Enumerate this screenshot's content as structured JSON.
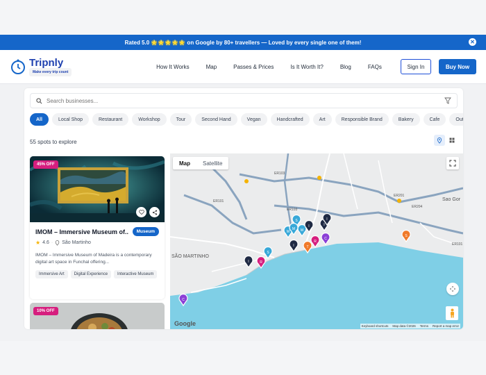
{
  "banner": {
    "text": "Rated 5.0 🌟🌟🌟🌟🌟 on Google by 80+ travellers — Loved by every single one of them!"
  },
  "brand": {
    "name": "Tripnly",
    "tagline": "Make every trip count",
    "color": "#1566c9"
  },
  "nav": [
    "How It Works",
    "Map",
    "Passes & Prices",
    "Is It Worth It?",
    "Blog",
    "FAQs"
  ],
  "auth": {
    "signin": "Sign In",
    "buy": "Buy Now"
  },
  "search": {
    "placeholder": "Search businesses..."
  },
  "filters": [
    "All",
    "Local Shop",
    "Restaurant",
    "Workshop",
    "Tour",
    "Second Hand",
    "Vegan",
    "Handcrafted",
    "Art",
    "Responsible Brand",
    "Bakery",
    "Cafe",
    "Outdoor"
  ],
  "results": {
    "count": "55 spots to explore"
  },
  "card": {
    "discount": "45% OFF",
    "title": "IMOM – Immersive Museum of...",
    "category": "Museum",
    "rating": "4.6",
    "location": "São Martinho",
    "description": "IMOM – Immersive Museum of Madeira is a contemporary digital art space in Funchal offering...",
    "tags": [
      "Immersive Art",
      "Digital Experience",
      "Interactive Museum"
    ]
  },
  "card2": {
    "discount": "10% OFF"
  },
  "map": {
    "tabs": [
      "Map",
      "Satellite"
    ],
    "labels": [
      "SÃO MARTINHO",
      "Sao Gor",
      "ER103",
      "ER101",
      "ER201",
      "ER204",
      "ER103",
      "ER101"
    ],
    "attribution": [
      "Keyboard shortcuts",
      "Map data ©2026",
      "Terms",
      "Report a map error"
    ],
    "logo": "Google",
    "pins": [
      {
        "label": "S",
        "color": "#38a8d8"
      },
      {
        "label": "M",
        "color": "#38a8d8"
      },
      {
        "label": "M",
        "color": "#38a8d8"
      },
      {
        "label": "M",
        "color": "#38a8d8"
      },
      {
        "label": "I",
        "color": "#1f2a44"
      },
      {
        "label": "I",
        "color": "#1f2a44"
      },
      {
        "label": "I",
        "color": "#1f2a44"
      },
      {
        "label": "I",
        "color": "#1f2a44"
      },
      {
        "label": "R",
        "color": "#d61e7e"
      },
      {
        "label": "R",
        "color": "#d61e7e"
      },
      {
        "label": "C",
        "color": "#8b3fd6"
      },
      {
        "label": "C",
        "color": "#8b3fd6"
      },
      {
        "label": "T",
        "color": "#f07a2a"
      },
      {
        "label": "S",
        "color": "#f07a2a"
      },
      {
        "label": "S",
        "color": "#38a8d8"
      },
      {
        "label": "I",
        "color": "#1f2a44"
      }
    ]
  }
}
